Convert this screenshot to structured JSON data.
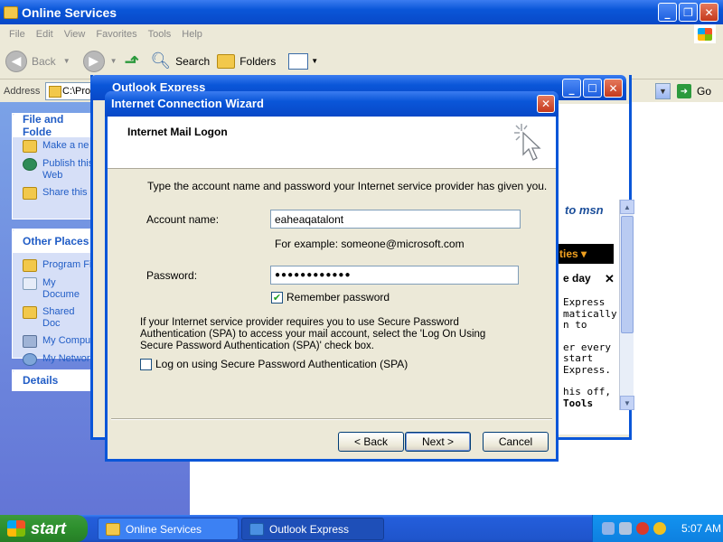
{
  "explorer": {
    "title": "Online Services",
    "menu": [
      "File",
      "Edit",
      "View",
      "Favorites",
      "Tools",
      "Help"
    ],
    "toolbar": {
      "back": "Back",
      "search": "Search",
      "folders": "Folders"
    },
    "address_label": "Address",
    "address_value": "C:\\Pro",
    "go_label": "Go",
    "file_folder_tasks": {
      "title": "File and Folder Tasks",
      "items": [
        "Make a new folder",
        "Publish this folder to the Web",
        "Share this folder"
      ]
    },
    "file_folder_visible": {
      "title": "File and Folde",
      "items": [
        "Make a ne",
        "Publish this",
        "Web",
        "Share this"
      ]
    },
    "other_places": {
      "title": "Other Places",
      "items": [
        "Program Fi",
        "My Docume",
        "Shared Doc",
        "My Compu",
        "My Networ"
      ]
    },
    "details": {
      "title": "Details"
    }
  },
  "outlook": {
    "title": "Outlook Express",
    "msn": "to msn",
    "ties": "ties",
    "of_day": "e day",
    "text_lines": [
      "Express",
      "matically",
      "n to",
      "",
      "er every",
      "start",
      "Express.",
      "",
      "his off,",
      "Tools"
    ]
  },
  "wizard": {
    "title": "Internet Connection Wizard",
    "heading": "Internet Mail Logon",
    "intro": "Type the account name and password your Internet service provider has given you.",
    "account_label": "Account name:",
    "account_value": "eaheaqatalont",
    "example": "For example: someone@microsoft.com",
    "password_label": "Password:",
    "password_value": "●●●●●●●●●●●●",
    "remember_label": "Remember password",
    "remember_checked": true,
    "spa_text": "If your Internet service provider requires you to use Secure Password Authentication (SPA) to access your mail account, select the 'Log On Using Secure Password Authentication (SPA)' check box.",
    "spa_checkbox_label": "Log on using Secure Password Authentication (SPA)",
    "spa_checked": false,
    "back_button": "< Back",
    "next_button": "Next >",
    "cancel_button": "Cancel"
  },
  "taskbar": {
    "start": "start",
    "tasks": [
      "Online Services",
      "Outlook Express"
    ],
    "clock": "5:07 AM"
  },
  "colors": {
    "titlebar": "#0a56d8",
    "taskbar": "#245edb",
    "start": "#2d8f2d"
  }
}
